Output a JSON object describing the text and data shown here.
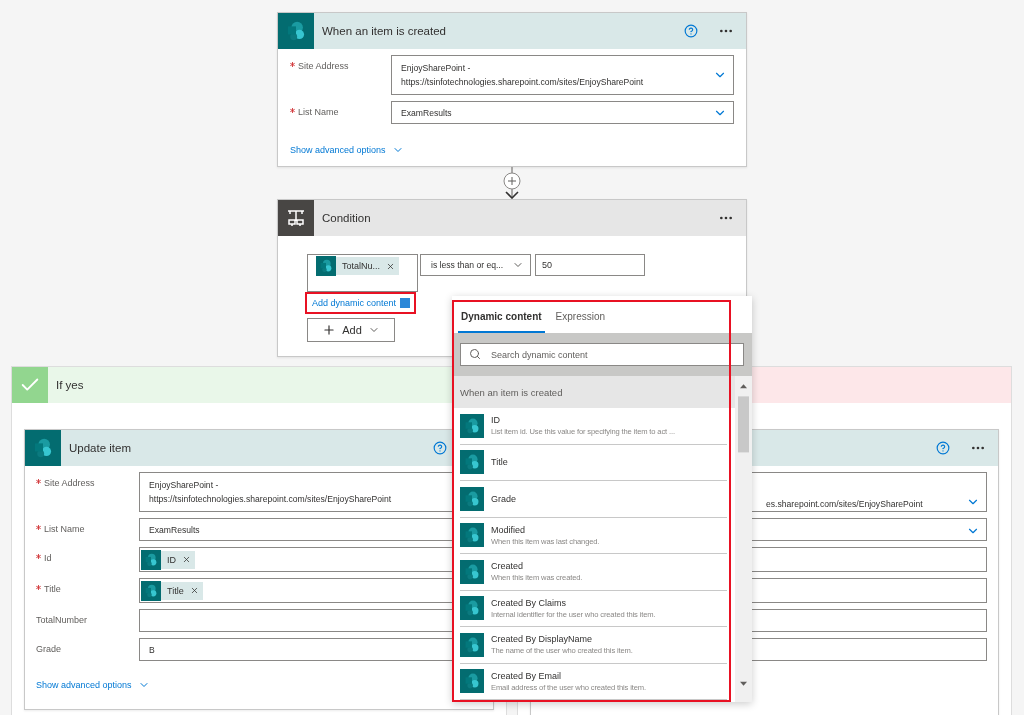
{
  "trigger": {
    "title": "When an item is created",
    "fields": [
      {
        "label": "Site Address",
        "required": true,
        "kind": "address",
        "chevron": true,
        "lines": [
          "EnjoySharePoint -",
          "https://tsinfotechnologies.sharepoint.com/sites/EnjoySharePoint"
        ]
      },
      {
        "label": "List Name",
        "required": true,
        "kind": "line",
        "chevron": true,
        "lines": [
          "ExamResults"
        ]
      }
    ],
    "advanced": "Show advanced options"
  },
  "condition": {
    "title": "Condition",
    "token": "TotalNu...",
    "operator": "is less than or eq...",
    "value": "50",
    "dynamic_link": "Add dynamic content",
    "add_button": "Add"
  },
  "yes_branch": {
    "title": "If yes",
    "action": {
      "title": "Update item",
      "fields": [
        {
          "label": "Site Address",
          "required": true,
          "kind": "address",
          "lines": [
            "EnjoySharePoint -",
            "https://tsinfotechnologies.sharepoint.com/sites/EnjoySharePoint"
          ]
        },
        {
          "label": "List Name",
          "required": true,
          "kind": "line",
          "lines": [
            "ExamResults"
          ]
        },
        {
          "label": "Id",
          "required": true,
          "kind": "token",
          "tokens": [
            "ID"
          ]
        },
        {
          "label": "Title",
          "required": true,
          "kind": "token",
          "tokens": [
            "Title"
          ]
        },
        {
          "label": "TotalNumber",
          "kind": "line"
        },
        {
          "label": "Grade",
          "kind": "line",
          "lines": [
            "B"
          ]
        }
      ],
      "advanced": "Show advanced options"
    }
  },
  "no_branch": {
    "action": {
      "fields": [
        {
          "kind": "address",
          "chevron": true,
          "lines": [
            "es.sharepoint.com/sites/EnjoySharePoint"
          ]
        },
        {
          "kind": "line",
          "chevron": true
        },
        {
          "kind": "token"
        },
        {
          "kind": "token"
        },
        {
          "kind": "line"
        },
        {
          "kind": "line"
        }
      ]
    }
  },
  "popup": {
    "tabs": [
      {
        "label": "Dynamic content",
        "selected": true
      },
      {
        "label": "Expression",
        "selected": false
      }
    ],
    "search": {
      "placeholder": "Search dynamic content"
    },
    "section": "When an item is created",
    "items": [
      {
        "title": "ID",
        "description": "List item id. Use this value for specifying the item to act ..."
      },
      {
        "title": "Title"
      },
      {
        "title": "Grade"
      },
      {
        "title": "Modified",
        "description": "When this item was last changed."
      },
      {
        "title": "Created",
        "description": "When this item was created."
      },
      {
        "title": "Created By Claims",
        "description": "Internal identifier for the user who created this item."
      },
      {
        "title": "Created By DisplayName",
        "description": "The name of the user who created this item."
      },
      {
        "title": "Created By Email",
        "description": "Email address of the user who created this item."
      }
    ]
  }
}
